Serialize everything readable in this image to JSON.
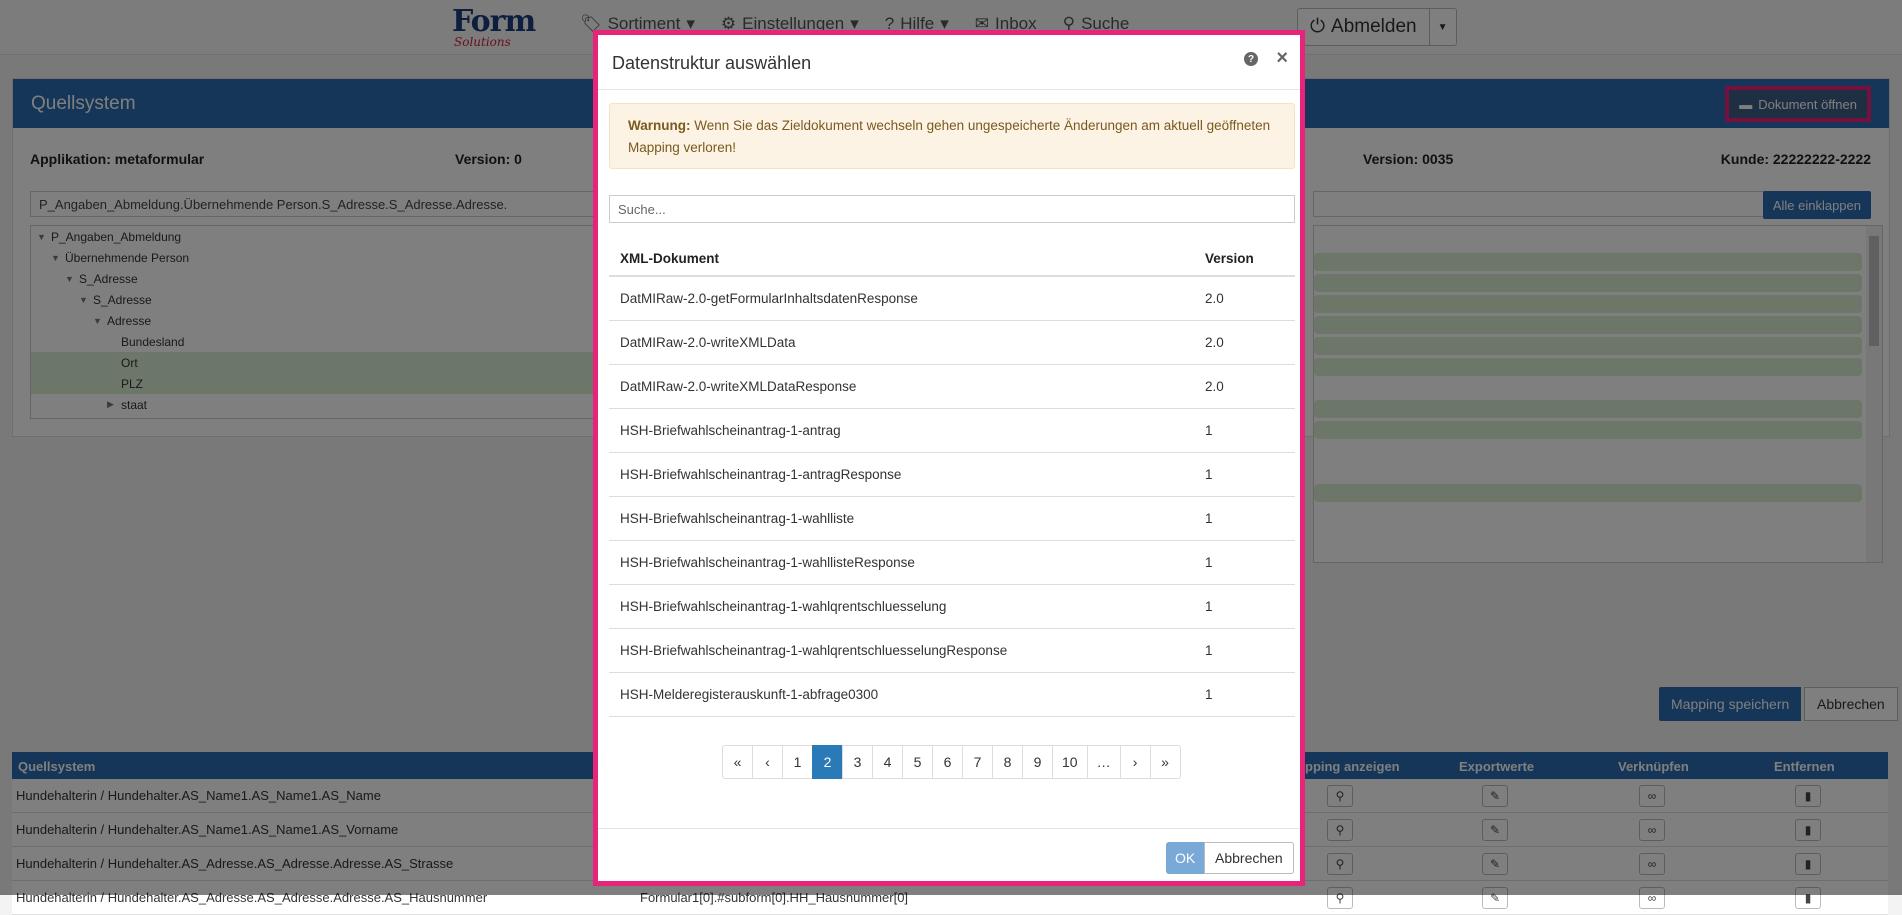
{
  "navbar": {
    "logo_main": "Form",
    "logo_sub": "Solutions",
    "links": [
      {
        "label": "Sortiment",
        "icon": "tag-icon"
      },
      {
        "label": "Einstellungen",
        "icon": "gear-icon"
      },
      {
        "label": "Hilfe",
        "icon": "help-icon"
      },
      {
        "label": "Inbox",
        "icon": "envelope-icon"
      },
      {
        "label": "Suche",
        "icon": "search-icon"
      }
    ],
    "logout_label": "Abmelden"
  },
  "panel": {
    "title": "Quellsystem",
    "open_doc_label": "Dokument öffnen",
    "app_label": "Applikation: metaformular",
    "version_label": "Version: 0",
    "version_right_label": "Version: 0035",
    "customer_label": "Kunde: 22222222-2222",
    "path_value": "P_Angaben_Abmeldung.Übernehmende Person.S_Adresse.S_Adresse.Adresse.",
    "collapse_label": "Alle einklappen",
    "tree": [
      {
        "label": "P_Angaben_Abmeldung",
        "tri": "▼"
      },
      {
        "label": "Übernehmende Person",
        "tri": "▼"
      },
      {
        "label": "S_Adresse",
        "tri": "▼"
      },
      {
        "label": "S_Adresse",
        "tri": "▼"
      },
      {
        "label": "Adresse",
        "tri": "▼"
      },
      {
        "label": "Bundesland",
        "tri": ""
      },
      {
        "label": "Ort",
        "tri": ""
      },
      {
        "label": "PLZ",
        "tri": ""
      },
      {
        "label": "staat",
        "tri": "▶"
      }
    ]
  },
  "actions": {
    "save_mapping": "Mapping speichern",
    "cancel": "Abbrechen"
  },
  "table": {
    "headers": {
      "source": "Quellsystem",
      "show_mapping": "pping anzeigen",
      "export": "Exportwerte",
      "link": "Verknüpfen",
      "remove": "Entfernen"
    },
    "rows": [
      {
        "source": "Hundehalterin / Hundehalter.AS_Name1.AS_Name1.AS_Name",
        "target": ""
      },
      {
        "source": "Hundehalterin / Hundehalter.AS_Name1.AS_Name1.AS_Vorname",
        "target": ""
      },
      {
        "source": "Hundehalterin / Hundehalter.AS_Adresse.AS_Adresse.Adresse.AS_Strasse",
        "target": ""
      },
      {
        "source": "Hundehalterin / Hundehalter.AS_Adresse.AS_Adresse.Adresse.AS_Hausnummer",
        "target": "Formular1[0].#subform[0].HH_Hausnummer[0]"
      }
    ]
  },
  "modal": {
    "title": "Datenstruktur auswählen",
    "warning_bold": "Warnung:",
    "warning_text": " Wenn Sie das Zieldokument wechseln gehen ungespeicherte Änderungen am aktuell geöffneten Mapping verloren!",
    "search_placeholder": "Suche...",
    "col_doc": "XML-Dokument",
    "col_version": "Version",
    "rows": [
      {
        "doc": "DatMIRaw-2.0-getFormularInhaltsdatenResponse",
        "version": "2.0"
      },
      {
        "doc": "DatMIRaw-2.0-writeXMLData",
        "version": "2.0"
      },
      {
        "doc": "DatMIRaw-2.0-writeXMLDataResponse",
        "version": "2.0"
      },
      {
        "doc": "HSH-Briefwahlscheinantrag-1-antrag",
        "version": "1"
      },
      {
        "doc": "HSH-Briefwahlscheinantrag-1-antragResponse",
        "version": "1"
      },
      {
        "doc": "HSH-Briefwahlscheinantrag-1-wahlliste",
        "version": "1"
      },
      {
        "doc": "HSH-Briefwahlscheinantrag-1-wahllisteResponse",
        "version": "1"
      },
      {
        "doc": "HSH-Briefwahlscheinantrag-1-wahlqrentschluesselung",
        "version": "1"
      },
      {
        "doc": "HSH-Briefwahlscheinantrag-1-wahlqrentschluesselungResponse",
        "version": "1"
      },
      {
        "doc": "HSH-Melderegisterauskunft-1-abfrage0300",
        "version": "1"
      }
    ],
    "pager": [
      "«",
      "‹",
      "1",
      "2",
      "3",
      "4",
      "5",
      "6",
      "7",
      "8",
      "9",
      "10",
      "…",
      "›",
      "»"
    ],
    "active_page": "2",
    "ok_label": "OK",
    "cancel_label": "Abbrechen"
  }
}
